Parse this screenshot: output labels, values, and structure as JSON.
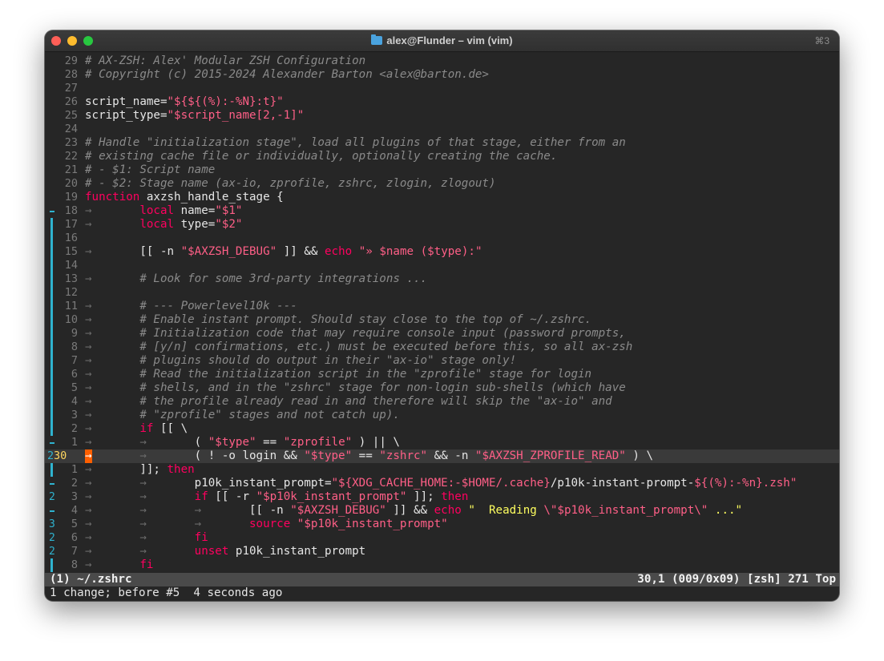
{
  "window": {
    "title": "alex@Flunder – vim (vim)",
    "shortcut": "⌘3",
    "title_icon": "folder-icon"
  },
  "lines": [
    {
      "num": "29",
      "sign": "",
      "segments": [
        {
          "t": "# AX-ZSH: Alex' Modular ZSH Configuration",
          "c": "c"
        }
      ]
    },
    {
      "num": "28",
      "sign": "",
      "segments": [
        {
          "t": "# Copyright (c) 2015-2024 Alexander Barton <alex@barton.de>",
          "c": "c"
        }
      ]
    },
    {
      "num": "27",
      "sign": "",
      "segments": []
    },
    {
      "num": "26",
      "sign": "",
      "segments": [
        {
          "t": "script_name=",
          "c": "w"
        },
        {
          "t": "\"${${(%):-%N}:t}\"",
          "c": "s"
        }
      ]
    },
    {
      "num": "25",
      "sign": "",
      "segments": [
        {
          "t": "script_type=",
          "c": "w"
        },
        {
          "t": "\"$script_name[2,-1]\"",
          "c": "s"
        }
      ]
    },
    {
      "num": "24",
      "sign": "",
      "segments": []
    },
    {
      "num": "23",
      "sign": "",
      "segments": [
        {
          "t": "# Handle \"initialization stage\", load all plugins of that stage, either from an",
          "c": "c"
        }
      ]
    },
    {
      "num": "22",
      "sign": "",
      "segments": [
        {
          "t": "# existing cache file or individually, optionally creating the cache.",
          "c": "c"
        }
      ]
    },
    {
      "num": "21",
      "sign": "",
      "segments": [
        {
          "t": "# - $1: Script name",
          "c": "c"
        }
      ]
    },
    {
      "num": "20",
      "sign": "",
      "segments": [
        {
          "t": "# - $2: Stage name (ax-io, zprofile, zshrc, zlogin, zlogout)",
          "c": "c"
        }
      ]
    },
    {
      "num": "19",
      "sign": "",
      "segments": [
        {
          "t": "function",
          "c": "k"
        },
        {
          "t": " axzsh_handle_stage {",
          "c": "w"
        }
      ]
    },
    {
      "num": "18",
      "sign": "dash",
      "segments": [
        {
          "t": "→       ",
          "c": "a"
        },
        {
          "t": "local",
          "c": "k"
        },
        {
          "t": " name=",
          "c": "w"
        },
        {
          "t": "\"$1\"",
          "c": "s"
        }
      ]
    },
    {
      "num": "17",
      "sign": "bar",
      "segments": [
        {
          "t": "→       ",
          "c": "a"
        },
        {
          "t": "local",
          "c": "k"
        },
        {
          "t": " type=",
          "c": "w"
        },
        {
          "t": "\"$2\"",
          "c": "s"
        }
      ]
    },
    {
      "num": "16",
      "sign": "bar",
      "segments": []
    },
    {
      "num": "15",
      "sign": "bar",
      "segments": [
        {
          "t": "→       ",
          "c": "a"
        },
        {
          "t": "[[ -n ",
          "c": "w"
        },
        {
          "t": "\"$AXZSH_DEBUG\"",
          "c": "s"
        },
        {
          "t": " ]] && ",
          "c": "w"
        },
        {
          "t": "echo",
          "c": "k"
        },
        {
          "t": " ",
          "c": "w"
        },
        {
          "t": "\"» ",
          "c": "s"
        },
        {
          "t": "$name",
          "c": "v"
        },
        {
          "t": " (",
          "c": "s"
        },
        {
          "t": "$type",
          "c": "v"
        },
        {
          "t": "):\"",
          "c": "s"
        }
      ]
    },
    {
      "num": "14",
      "sign": "bar",
      "segments": []
    },
    {
      "num": "13",
      "sign": "bar",
      "segments": [
        {
          "t": "→       ",
          "c": "a"
        },
        {
          "t": "# Look for some 3rd-party integrations ...",
          "c": "c"
        }
      ]
    },
    {
      "num": "12",
      "sign": "bar",
      "segments": []
    },
    {
      "num": "11",
      "sign": "bar",
      "segments": [
        {
          "t": "→       ",
          "c": "a"
        },
        {
          "t": "# --- Powerlevel10k ---",
          "c": "c"
        }
      ]
    },
    {
      "num": "10",
      "sign": "bar",
      "segments": [
        {
          "t": "→       ",
          "c": "a"
        },
        {
          "t": "# Enable instant prompt. Should stay close to the top of ~/.zshrc.",
          "c": "c"
        }
      ]
    },
    {
      "num": "9",
      "sign": "bar",
      "segments": [
        {
          "t": "→       ",
          "c": "a"
        },
        {
          "t": "# Initialization code that may require console input (password prompts,",
          "c": "c"
        }
      ]
    },
    {
      "num": "8",
      "sign": "bar",
      "segments": [
        {
          "t": "→       ",
          "c": "a"
        },
        {
          "t": "# [y/n] confirmations, etc.) must be executed before this, so all ax-zsh",
          "c": "c"
        }
      ]
    },
    {
      "num": "7",
      "sign": "bar",
      "segments": [
        {
          "t": "→       ",
          "c": "a"
        },
        {
          "t": "# plugins should do output in their \"ax-io\" stage only!",
          "c": "c"
        }
      ]
    },
    {
      "num": "6",
      "sign": "bar",
      "segments": [
        {
          "t": "→       ",
          "c": "a"
        },
        {
          "t": "# Read the initialization script in the \"zprofile\" stage for login",
          "c": "c"
        }
      ]
    },
    {
      "num": "5",
      "sign": "bar",
      "segments": [
        {
          "t": "→       ",
          "c": "a"
        },
        {
          "t": "# shells, and in the \"zshrc\" stage for non-login sub-shells (which have",
          "c": "c"
        }
      ]
    },
    {
      "num": "4",
      "sign": "bar",
      "segments": [
        {
          "t": "→       ",
          "c": "a"
        },
        {
          "t": "# the profile already read in and therefore will skip the \"ax-io\" and",
          "c": "c"
        }
      ]
    },
    {
      "num": "3",
      "sign": "bar",
      "segments": [
        {
          "t": "→       ",
          "c": "a"
        },
        {
          "t": "# \"zprofile\" stages and not catch up).",
          "c": "c"
        }
      ]
    },
    {
      "num": "2",
      "sign": "bar",
      "segments": [
        {
          "t": "→       ",
          "c": "a"
        },
        {
          "t": "if",
          "c": "k"
        },
        {
          "t": " [[ \\",
          "c": "w"
        }
      ]
    },
    {
      "num": "1",
      "sign": "dash",
      "segments": [
        {
          "t": "→       →       ",
          "c": "a"
        },
        {
          "t": "( ",
          "c": "w"
        },
        {
          "t": "\"$type\"",
          "c": "s"
        },
        {
          "t": " == ",
          "c": "w"
        },
        {
          "t": "\"zprofile\"",
          "c": "s"
        },
        {
          "t": " ) || \\",
          "c": "w"
        }
      ]
    },
    {
      "num": "30",
      "sign": "2",
      "current": true,
      "segments": [
        {
          "t": "→",
          "c": "cursor"
        },
        {
          "t": "       →       ",
          "c": "a"
        },
        {
          "t": "( ! -o login && ",
          "c": "w"
        },
        {
          "t": "\"$type\"",
          "c": "s"
        },
        {
          "t": " == ",
          "c": "w"
        },
        {
          "t": "\"zshrc\"",
          "c": "s"
        },
        {
          "t": " && -n ",
          "c": "w"
        },
        {
          "t": "\"$AXZSH_ZPROFILE_READ\"",
          "c": "s"
        },
        {
          "t": " ) \\",
          "c": "w"
        }
      ]
    },
    {
      "num": "1",
      "sign": "bar",
      "segments": [
        {
          "t": "→       ",
          "c": "a"
        },
        {
          "t": "]]; ",
          "c": "w"
        },
        {
          "t": "then",
          "c": "k"
        }
      ]
    },
    {
      "num": "2",
      "sign": "dash",
      "segments": [
        {
          "t": "→       →       ",
          "c": "a"
        },
        {
          "t": "p10k_instant_prompt=",
          "c": "w"
        },
        {
          "t": "\"${XDG_CACHE_HOME:-$HOME/.cache}",
          "c": "s"
        },
        {
          "t": "/p10k-instant-prompt-",
          "c": "w"
        },
        {
          "t": "${(%):-%n}",
          "c": "s"
        },
        {
          "t": ".zsh\"",
          "c": "s"
        }
      ]
    },
    {
      "num": "3",
      "sign": "2",
      "segments": [
        {
          "t": "→       →       ",
          "c": "a"
        },
        {
          "t": "if",
          "c": "k"
        },
        {
          "t": " [[ -r ",
          "c": "w"
        },
        {
          "t": "\"$p10k_instant_prompt\"",
          "c": "s"
        },
        {
          "t": " ]]; ",
          "c": "w"
        },
        {
          "t": "then",
          "c": "k"
        }
      ]
    },
    {
      "num": "4",
      "sign": "dash",
      "segments": [
        {
          "t": "→       →       →       ",
          "c": "a"
        },
        {
          "t": "[[ -n ",
          "c": "w"
        },
        {
          "t": "\"$AXZSH_DEBUG\"",
          "c": "s"
        },
        {
          "t": " ]] && ",
          "c": "w"
        },
        {
          "t": "echo",
          "c": "k"
        },
        {
          "t": " ",
          "c": "w"
        },
        {
          "t": "\"  Reading ",
          "c": "y"
        },
        {
          "t": "\\\"",
          "c": "s"
        },
        {
          "t": "$p10k_instant_prompt",
          "c": "v"
        },
        {
          "t": "\\\"",
          "c": "s"
        },
        {
          "t": " ...\"",
          "c": "y"
        }
      ]
    },
    {
      "num": "5",
      "sign": "3",
      "segments": [
        {
          "t": "→       →       →       ",
          "c": "a"
        },
        {
          "t": "source",
          "c": "k"
        },
        {
          "t": " ",
          "c": "w"
        },
        {
          "t": "\"$p10k_instant_prompt\"",
          "c": "s"
        }
      ]
    },
    {
      "num": "6",
      "sign": "2",
      "segments": [
        {
          "t": "→       →       ",
          "c": "a"
        },
        {
          "t": "fi",
          "c": "k"
        }
      ]
    },
    {
      "num": "7",
      "sign": "2",
      "segments": [
        {
          "t": "→       →       ",
          "c": "a"
        },
        {
          "t": "unset",
          "c": "k"
        },
        {
          "t": " p10k_instant_prompt",
          "c": "w"
        }
      ]
    },
    {
      "num": "8",
      "sign": "bar",
      "segments": [
        {
          "t": "→       ",
          "c": "a"
        },
        {
          "t": "fi",
          "c": "k"
        }
      ]
    }
  ],
  "statusline": {
    "left": "(1) ~/.zshrc",
    "right": "30,1 (009/0x09) [zsh] 271 Top"
  },
  "message": "1 change; before #5  4 seconds ago"
}
